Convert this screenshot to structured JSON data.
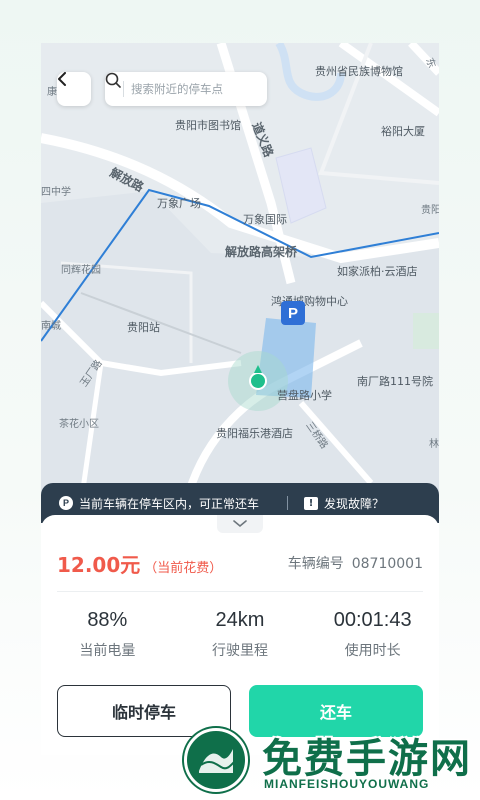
{
  "search": {
    "placeholder": "搜索附近的停车点"
  },
  "map": {
    "labels": {
      "l1": "贵州省民族博物馆",
      "l2": "康",
      "l3": "贵阳市图书馆",
      "l4": "道义路",
      "l5": "裕阳大厦",
      "l6": "解放路",
      "l7": "四中学",
      "l8": "万象广场",
      "l9": "万象国际",
      "l10": "贵阳",
      "l11": "解放路高架桥",
      "l12": "同辉花园",
      "l13": "如家派柏·云酒店",
      "l14": "南城",
      "l15": "贵阳站",
      "l16": "鸿通城购物中心",
      "l17": "玉厂路",
      "l18": "营盘路小学",
      "l19": "南厂路111号院",
      "l20": "茶花小区",
      "l21": "贵阳福乐港酒店",
      "l22": "三桥路",
      "l23": "林",
      "l24": "东"
    },
    "parking_marker": "P"
  },
  "notice": {
    "message": "当前车辆在停车区内，可正常还车",
    "fault_link": "发现故障？",
    "p_icon": "P",
    "fault_icon": "!"
  },
  "panel": {
    "fee_amount": "12.00元",
    "fee_note": "（当前花费）",
    "vehicle_label": "车辆编号",
    "vehicle_number": "08710001",
    "stats": [
      {
        "value": "88%",
        "label": "当前电量"
      },
      {
        "value": "24km",
        "label": "行驶里程"
      },
      {
        "value": "00:01:43",
        "label": "使用时长"
      }
    ],
    "temp_park_button": "临时停车",
    "return_button": "还车"
  },
  "watermark": {
    "title": "免费手游网",
    "subtitle": "MIANFEISHOUYOUWANG"
  },
  "colors": {
    "accent": "#21d6a9",
    "fee": "#f05a4b",
    "notice_bg": "#2d3e4e",
    "route": "#2f7fd6"
  }
}
